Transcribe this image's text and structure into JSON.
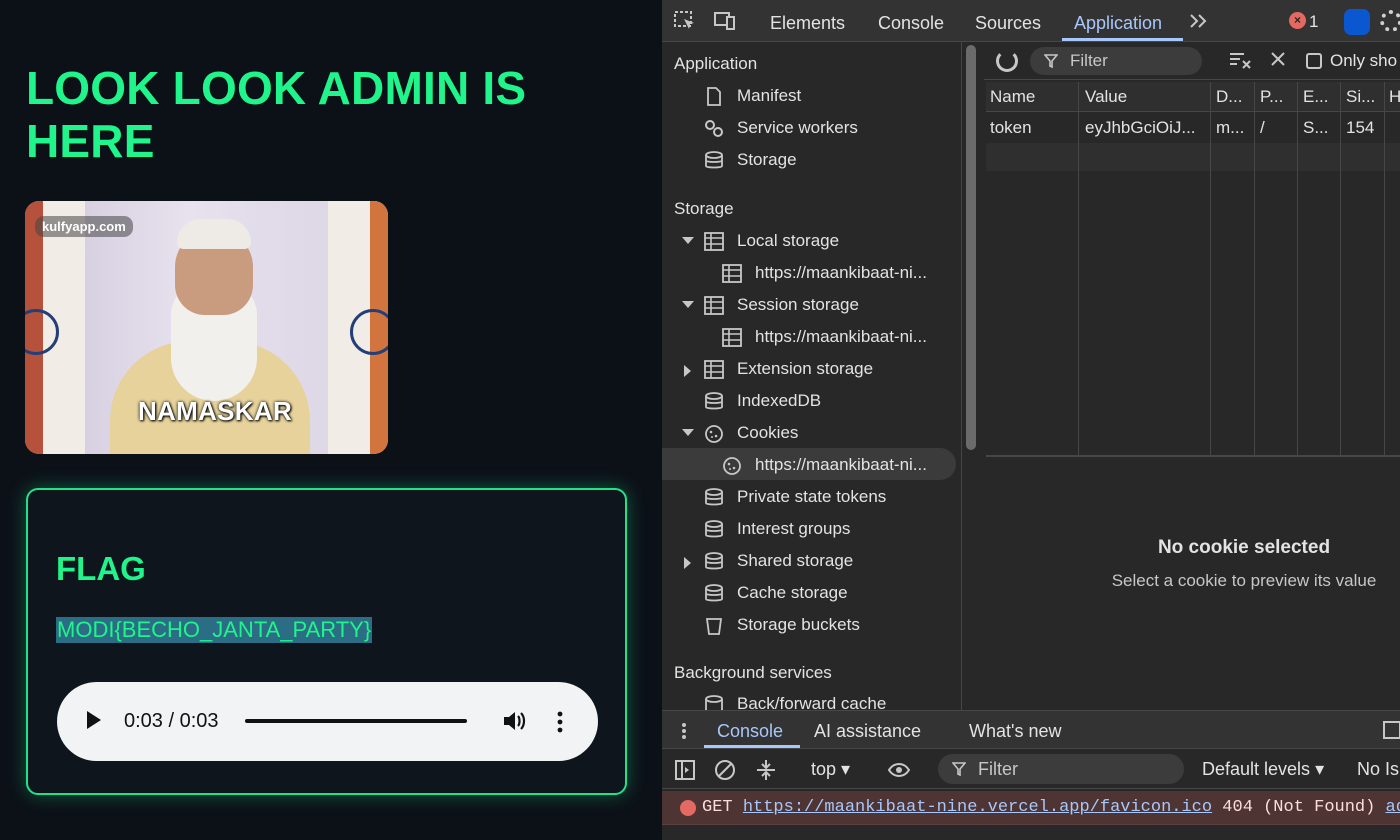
{
  "page": {
    "title": "LOOK LOOK ADMIN IS HERE",
    "gif": {
      "watermark": "kulfyapp.com",
      "caption": "NAMASKAR"
    },
    "flag_card": {
      "heading": "FLAG",
      "value": "MODI{BECHO_JANTA_PARTY}",
      "audio": {
        "time": "0:03 / 0:03",
        "progress": 1.0
      }
    }
  },
  "devtools": {
    "tabs": [
      "Elements",
      "Console",
      "Sources",
      "Application"
    ],
    "active_tab": "Application",
    "error_count": "1",
    "icons": {
      "inspect": "inspect-element-icon",
      "device": "device-toolbar-icon",
      "more": "chevron-double-right-icon",
      "error": "error-circle-icon",
      "ai": "ai-assistant-icon",
      "settings": "gear-icon"
    },
    "sidebar": {
      "application_section": "Application",
      "application_items": [
        "Manifest",
        "Service workers",
        "Storage"
      ],
      "storage_section": "Storage",
      "local_storage": "Local storage",
      "local_storage_origin": "https://maankibaat-ni...",
      "session_storage": "Session storage",
      "session_storage_origin": "https://maankibaat-ni...",
      "extension_storage": "Extension storage",
      "indexeddb": "IndexedDB",
      "cookies": "Cookies",
      "cookies_origin": "https://maankibaat-ni...",
      "private_state_tokens": "Private state tokens",
      "interest_groups": "Interest groups",
      "shared_storage": "Shared storage",
      "cache_storage": "Cache storage",
      "storage_buckets": "Storage buckets",
      "background_section": "Background services",
      "back_forward_cache": "Back/forward cache"
    },
    "cookies": {
      "filter_placeholder": "Filter",
      "only_show_label": "Only sho",
      "columns": [
        "Name",
        "Value",
        "D...",
        "P...",
        "E...",
        "Si...",
        "H"
      ],
      "rows": [
        [
          "token",
          "eyJhbGciOiJ...",
          "m...",
          "/",
          "S...",
          "154",
          ""
        ]
      ],
      "empty_title": "No cookie selected",
      "empty_subtitle": "Select a cookie to preview its value"
    },
    "drawer": {
      "tabs": [
        "Console",
        "AI assistance",
        "What's new"
      ],
      "active_tab": "Console",
      "context": "top",
      "filter_placeholder": "Filter",
      "levels": "Default levels",
      "no_issues": "No Is",
      "error_line": {
        "method": "GET",
        "url": "https://maankibaat-nine.vercel.app/favicon.ico",
        "status": "404 (Not Found)",
        "source": "admin:"
      }
    }
  }
}
